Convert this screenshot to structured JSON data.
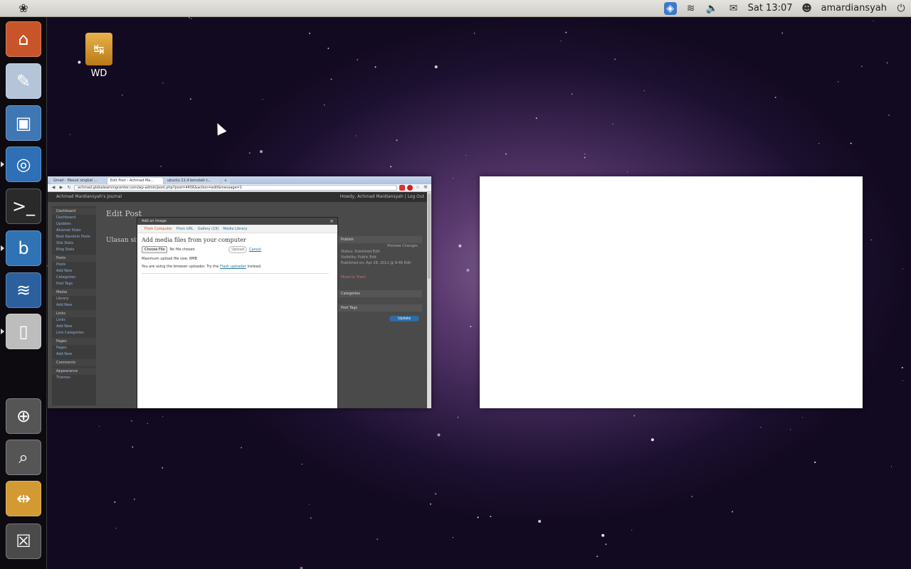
{
  "top_panel": {
    "app_menu_icon": "gnome-foot-icon",
    "clock": "Sat 13:07",
    "user": "amardiansyah"
  },
  "launcher": {
    "items": [
      {
        "name": "home-folder-icon",
        "color": "#c8552a"
      },
      {
        "name": "text-editor-icon",
        "color": "#b5c5d9"
      },
      {
        "name": "camera-icon",
        "color": "#3e77b4"
      },
      {
        "name": "chromium-icon",
        "color": "#2f6fb6"
      },
      {
        "name": "terminal-icon",
        "color": "#2a2a2a"
      },
      {
        "name": "blueprint-app-icon",
        "color": "#2f73b5"
      },
      {
        "name": "system-monitor-icon",
        "color": "#2c5f9e"
      },
      {
        "name": "document-viewer-icon",
        "color": "#bdbdbd"
      },
      {
        "name": "magnifier-icon",
        "color": "#555555"
      },
      {
        "name": "search-file-icon",
        "color": "#555555"
      },
      {
        "name": "usb-drive-icon",
        "color": "#d39a33"
      },
      {
        "name": "trash-icon",
        "color": "#4a4a4a"
      }
    ]
  },
  "desktop": {
    "drive_label": "WD"
  },
  "browser": {
    "tabs": [
      "Gmail - Masuk singkat ...",
      "Edit Post ‹ Achmad Ma...",
      "ubuntu 11.4 berubah t...",
      "+"
    ],
    "url": "achmad.globalearningcenter.com/wp-admin/post.php?post=4456&action=edit&message=1",
    "wp_site_title": "Achmad Mardiansyah's Journal",
    "wp_howdy": "Howdy, Achmad Mardiansyah | Log Out",
    "edit_title": "Edit Post",
    "post_title": "Ulasan singkat",
    "sidebar": [
      "Dashboard",
      "Dashboard",
      "Updates",
      "Akismet Stats",
      "Best Random Posts",
      "Site Stats",
      "Blog Stats",
      "Posts",
      "Posts",
      "Add New",
      "Categories",
      "Post Tags",
      "Media",
      "Library",
      "Add New",
      "Links",
      "Links",
      "Add New",
      "Link Categories",
      "Pages",
      "Pages",
      "Add New",
      "Comments",
      "Appearance",
      "Themes"
    ],
    "publish": {
      "head": "Publish",
      "preview": "Preview Changes",
      "status": "Status: Published Edit",
      "visibility": "Visibility: Public Edit",
      "published_on": "Published on: Apr 28, 2011 @ 8:46 Edit",
      "move_trash": "Move to Trash",
      "update": "Update"
    },
    "categories_head": "Categories",
    "tags_head": "Post Tags"
  },
  "dialog": {
    "title": "Add an Image",
    "tabs": [
      "From Computer",
      "From URL",
      "Gallery (19)",
      "Media Library"
    ],
    "heading": "Add media files from your computer",
    "choose_file": "Choose File",
    "no_file": "No file chosen",
    "upload": "Upload",
    "cancel": "Cancel",
    "max_size": "Maximum upload file size: 8MB",
    "uploader_note_pre": "You are using the browser uploader. Try the",
    "uploader_link": "Flash uploader",
    "uploader_note_post": "instead."
  }
}
